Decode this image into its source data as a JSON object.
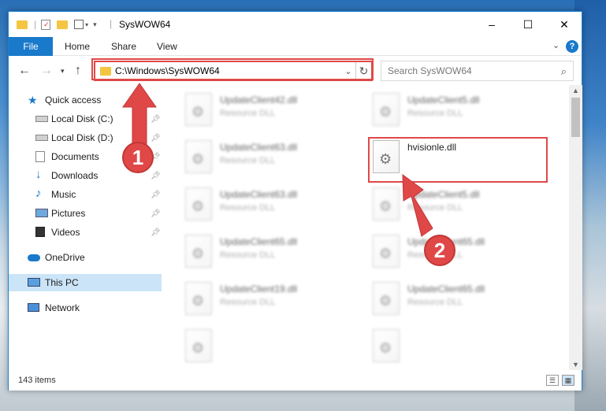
{
  "window": {
    "title": "SysWOW64",
    "controls": {
      "minimize": "–",
      "maximize": "☐",
      "close": "✕"
    }
  },
  "ribbon": {
    "file_tab": "File",
    "tabs": [
      "Home",
      "Share",
      "View"
    ],
    "help": "?"
  },
  "address_bar": {
    "path": "C:\\Windows\\SysWOW64"
  },
  "search": {
    "placeholder": "Search SysWOW64"
  },
  "sidebar": {
    "items": [
      {
        "label": "Quick access",
        "icon": "star-icon"
      },
      {
        "label": "Local Disk (C:)",
        "icon": "drive-icon",
        "pinned": true
      },
      {
        "label": "Local Disk (D:)",
        "icon": "drive-icon",
        "pinned": true
      },
      {
        "label": "Documents",
        "icon": "documents-icon",
        "pinned": true
      },
      {
        "label": "Downloads",
        "icon": "download-icon",
        "pinned": true
      },
      {
        "label": "Music",
        "icon": "music-icon",
        "pinned": true
      },
      {
        "label": "Pictures",
        "icon": "pictures-icon",
        "pinned": true
      },
      {
        "label": "Videos",
        "icon": "videos-icon",
        "pinned": true
      },
      {
        "label": "OneDrive",
        "icon": "cloud-icon"
      },
      {
        "label": "This PC",
        "icon": "computer-icon",
        "selected": true
      },
      {
        "label": "Network",
        "icon": "network-icon"
      }
    ]
  },
  "files": [
    {
      "name": "UpdateClient42.dll",
      "type": "Resource DLL",
      "blurred": true
    },
    {
      "name": "UpdateClient5.dll",
      "type": "Resource DLL",
      "blurred": true
    },
    {
      "name": "UpdateClient63.dll",
      "type": "Resource DLL",
      "blurred": true
    },
    {
      "name": "hvisionle.dll",
      "type": "",
      "blurred": false,
      "highlighted": true
    },
    {
      "name": "UpdateClient63.dll",
      "type": "Resource DLL",
      "blurred": true
    },
    {
      "name": "UpdateClient5.dll",
      "type": "Resource DLL",
      "blurred": true
    },
    {
      "name": "UpdateClient65.dll",
      "type": "Resource DLL",
      "blurred": true
    },
    {
      "name": "UpdateClient65.dll",
      "type": "Resource DLL",
      "blurred": true
    },
    {
      "name": "UpdateClient19.dll",
      "type": "Resource DLL",
      "blurred": true
    },
    {
      "name": "UpdateClient65.dll",
      "type": "Resource DLL",
      "blurred": true
    }
  ],
  "status": {
    "item_count": "143 items"
  },
  "callouts": {
    "step1": "1",
    "step2": "2",
    "color": "#e04848"
  }
}
